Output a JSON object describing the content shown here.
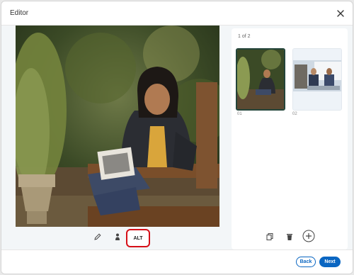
{
  "dialog": {
    "title": "Editor"
  },
  "icons": {
    "close": "close-icon",
    "edit": "pencil-icon",
    "tag": "person-icon",
    "duplicate": "copy-icon",
    "delete": "trash-icon",
    "add": "plus-icon"
  },
  "toolbar": {
    "alt_label": "ALT"
  },
  "panel": {
    "counter": "1 of 2",
    "thumbnails": [
      {
        "number": "01",
        "selected": true
      },
      {
        "number": "02",
        "selected": false
      }
    ]
  },
  "footer": {
    "back_label": "Back",
    "next_label": "Next"
  },
  "colors": {
    "accent": "#0a66c2",
    "alt_highlight": "#d60f18",
    "selected_border": "#24453a"
  }
}
